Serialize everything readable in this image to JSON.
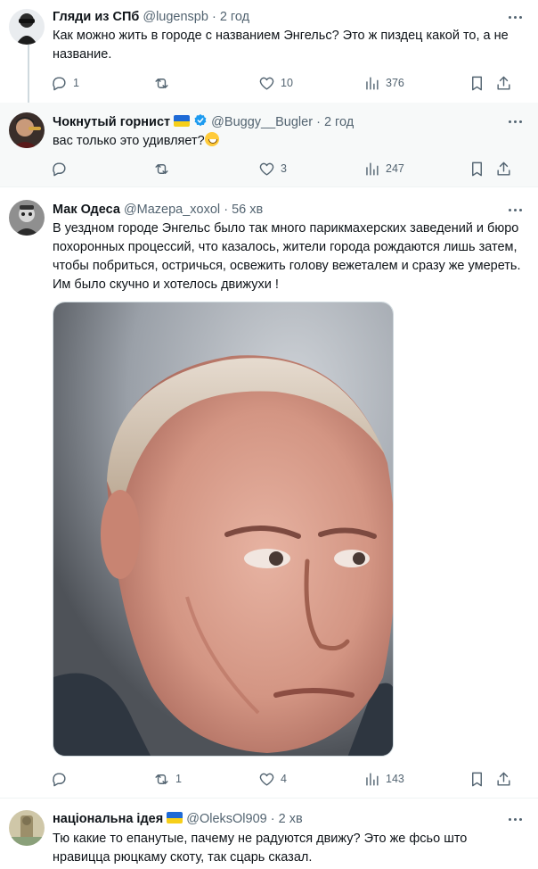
{
  "tweets": [
    {
      "name": "Гляди из СПб",
      "handle": "@lugenspb",
      "dot": "·",
      "time": "2 год",
      "text": "Как можно жить в городе с названием Энгельс? Это ж пиздец какой то, а не название.",
      "replies": "1",
      "reposts": "",
      "likes": "10",
      "views": "376"
    },
    {
      "name": "Чокнутый горнист",
      "handle": "@Buggy__Bugler",
      "dot": "·",
      "time": "2 год",
      "text": "вас только это удивляет?",
      "replies": "",
      "reposts": "",
      "likes": "3",
      "views": "247"
    },
    {
      "name": "Мак Одеса",
      "handle": "@Mazepa_xoxol",
      "dot": "·",
      "time": "56 хв",
      "text": "В уездном городе Энгельс было так много парикмахерских заведений и бюро похоронных процессий, что казалось, жители города рождаются лишь затем, чтобы побриться, остричься, освежить голову вежеталем и сразу же умереть. Им было скучно и хотелось движухи !",
      "replies": "",
      "reposts": "1",
      "likes": "4",
      "views": "143"
    },
    {
      "name": "національна ідея",
      "handle": "@OleksOl909",
      "dot": "·",
      "time": "2 хв",
      "text": "Тю какие то епанутые, пачему не радуются движу? Это же фсьо што нравицца рюцкаму скоту, так сцарь сказал."
    }
  ],
  "icons": {
    "reply": "reply-icon",
    "repost": "repost-icon",
    "like": "heart-icon",
    "views": "views-icon",
    "bookmark": "bookmark-icon",
    "share": "share-icon",
    "more": "more-icon"
  },
  "colors": {
    "text": "#0f1419",
    "secondary": "#536471",
    "verified": "#1d9bf0",
    "highlight_bg": "#f7f9f9"
  }
}
